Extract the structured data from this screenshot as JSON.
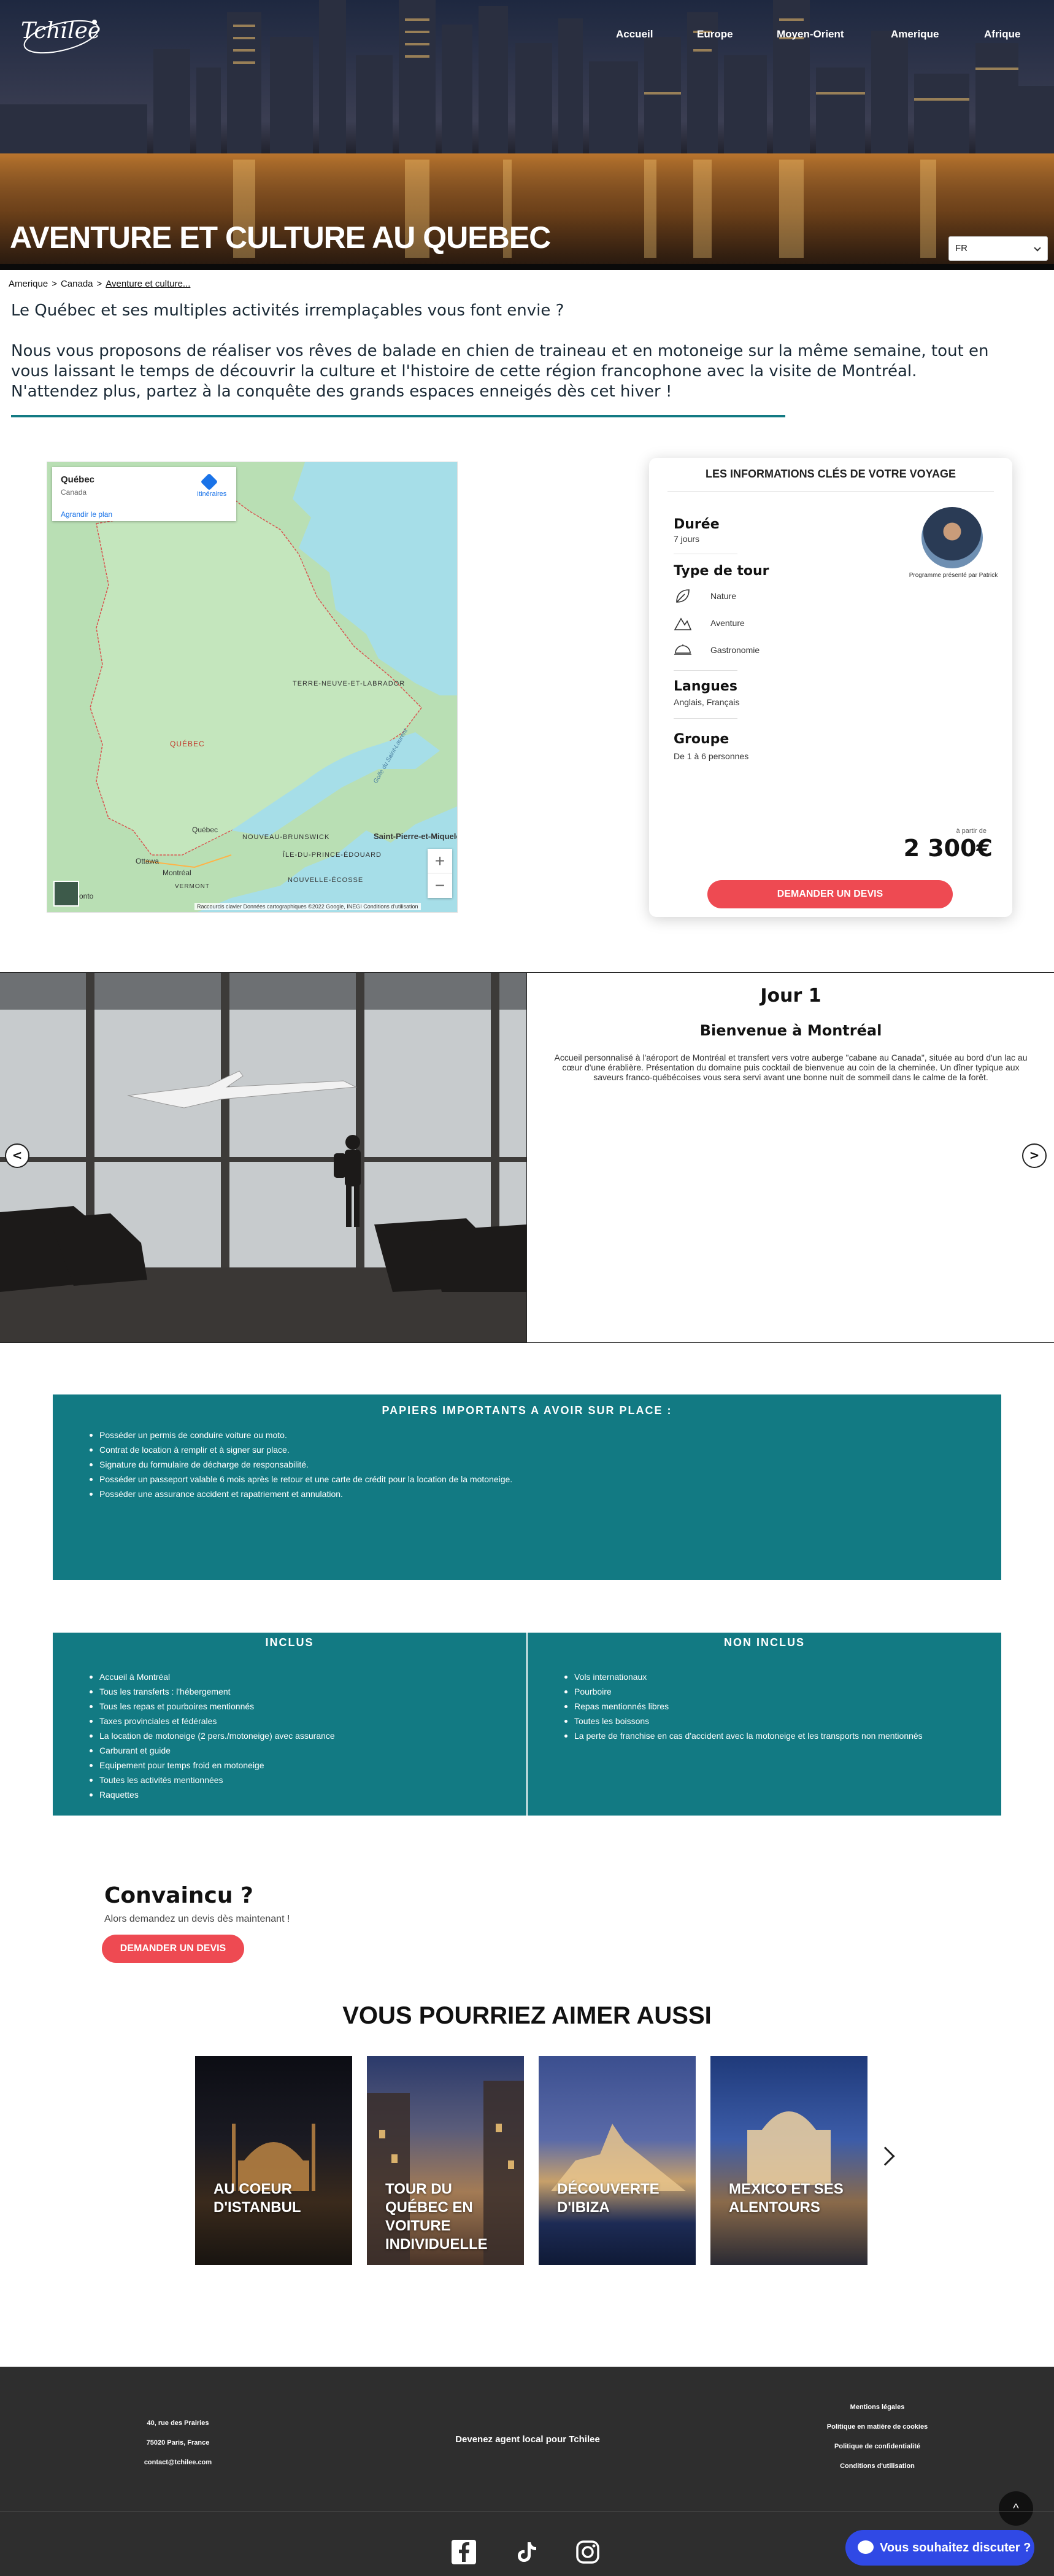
{
  "brand": {
    "logo_text": "Tchilee"
  },
  "nav": {
    "items": [
      "Accueil",
      "Europe",
      "Moyen-Orient",
      "Amerique",
      "Afrique"
    ]
  },
  "hero": {
    "title": "AVENTURE ET CULTURE AU QUEBEC"
  },
  "language": {
    "selected": "FR"
  },
  "breadcrumb": {
    "items": [
      "Amerique",
      "Canada",
      "Aventure et culture..."
    ],
    "separator": ">"
  },
  "intro": {
    "p1": "Le Québec et ses multiples activités irremplaçables vous font envie ?",
    "p2": "Nous vous proposons de réaliser vos rêves de balade en chien de traineau et en motoneige sur la même semaine, tout en vous laissant le temps de découvrir la culture et l'histoire de cette région francophone avec la visite de Montréal.",
    "p3": "N'attendez plus, partez à la conquête des grands espaces enneigés dès cet hiver !"
  },
  "map": {
    "place_title": "Québec",
    "place_sub": "Canada",
    "enlarge": "Agrandir le plan",
    "directions": "Itinéraires",
    "labels": {
      "quebec": "QUÉBEC",
      "terre_neuve": "TERRE-NEUVE-ET-LABRADOR",
      "quebec_city": "Québec",
      "ottawa": "Ottawa",
      "montreal": "Montréal",
      "nb": "NOUVEAU-BRUNSWICK",
      "ipe": "ÎLE-DU-PRINCE-ÉDOUARD",
      "ns": "NOUVELLE-ÉCOSSE",
      "spm": "Saint-Pierre-et-Miquelon",
      "vermont": "VERMONT",
      "toronto": "onto",
      "gulf": "Golfe du Saint-Laurent"
    },
    "footer": "Raccourcis clavier   Données cartographiques ©2022 Google, INEGI   Conditions d'utilisation",
    "zoom_in": "+",
    "zoom_out": "−"
  },
  "info": {
    "title": "LES INFORMATIONS CLÉS DE VOTRE VOYAGE",
    "duration_label": "Durée",
    "duration_value": "7 jours",
    "type_label": "Type de tour",
    "types": [
      "Nature",
      "Aventure",
      "Gastronomie"
    ],
    "languages_label": "Langues",
    "languages_value": "Anglais, Français",
    "group_label": "Groupe",
    "group_value": "De 1 à 6 personnes",
    "presenter": "Programme présenté par Patrick",
    "price_prefix": "à partir de",
    "price": "2 300€",
    "cta": "DEMANDER UN DEVIS"
  },
  "day": {
    "title": "Jour 1",
    "subtitle": "Bienvenue à Montréal",
    "text": "Accueil personnalisé à l'aéroport de Montréal et transfert vers votre auberge \"cabane au Canada\", située au bord d'un lac au cœur d'une érablière. Présentation du domaine puis cocktail de bienvenue au coin de la cheminée. Un dîner typique aux saveurs franco-québécoises vous sera servi avant une bonne nuit de sommeil dans le calme de la forêt.",
    "prev": "<",
    "next": ">"
  },
  "papers": {
    "title": "PAPIERS IMPORTANTS A AVOIR SUR PLACE :",
    "items": [
      "Posséder un permis de conduire voiture ou moto.",
      "Contrat de location à remplir et à signer sur place.",
      "Signature du formulaire de décharge de responsabilité.",
      "Posséder un passeport valable 6 mois après le retour et une carte de crédit pour la location de la motoneige.",
      "Posséder une assurance accident et rapatriement et annulation."
    ]
  },
  "included": {
    "title": "INCLUS",
    "items": [
      "Accueil à Montréal",
      "Tous les transferts : l'hébergement",
      "Tous les repas et pourboires mentionnés",
      "Taxes provinciales et fédérales",
      "La location de motoneige (2 pers./motoneige) avec assurance",
      "Carburant et guide",
      "Equipement pour temps froid en motoneige",
      "Toutes les activités mentionnées",
      "Raquettes"
    ]
  },
  "not_included": {
    "title": "NON INCLUS",
    "items": [
      "Vols internationaux",
      "Pourboire",
      "Repas mentionnés libres",
      "Toutes les boissons",
      "La perte de franchise en cas d'accident avec la motoneige et les transports non mentionnés"
    ]
  },
  "convinced": {
    "title": "Convaincu ?",
    "subtitle": "Alors demandez un devis dès maintenant !",
    "cta": "DEMANDER UN DEVIS"
  },
  "related": {
    "title": "VOUS POURRIEZ AIMER AUSSI",
    "cards": [
      "AU COEUR D'ISTANBUL",
      "TOUR DU QUÉBEC EN VOITURE INDIVIDUELLE",
      "DÉCOUVERTE D'IBIZA",
      "MEXICO ET SES ALENTOURS"
    ]
  },
  "footer": {
    "address": [
      "40, rue des Prairies",
      "75020 Paris, France",
      "contact@tchilee.com"
    ],
    "agent": "Devenez agent local pour Tchilee",
    "links": [
      "Mentions légales",
      "Politique en matière de cookies",
      "Politique de confidentialité",
      "Conditions d'utilisation"
    ],
    "back_to_top": "^",
    "chat": "Vous souhaitez discuter ?"
  }
}
